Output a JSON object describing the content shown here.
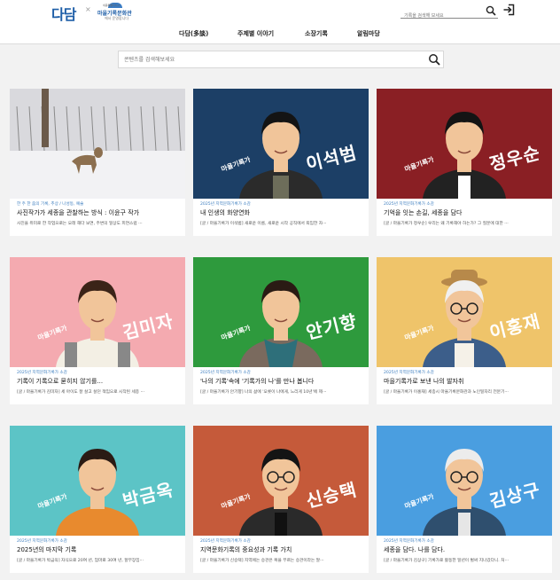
{
  "header": {
    "logo": "다담",
    "logo_dot": "×",
    "org_small": "세종특별자치시",
    "org_name": "마을기록문화관",
    "org_sub": "에서 운영합니다",
    "search_placeholder": "기록을 검색해 보세요"
  },
  "nav": [
    "다담(多談)",
    "주제별 이야기",
    "소장기록",
    "알림마당"
  ],
  "search": {
    "placeholder": "콘텐츠를 검색해보세요"
  },
  "colors": {
    "accent": "#3f7fc0",
    "logo": "#1f5fa8"
  },
  "cards": [
    {
      "category": "한 주 한 줌의 기록, 추상 / 나성동, 예술",
      "title": "사진작가가 세종을 관찰하는 방식 : 이윤구 작가",
      "desc": "사진을 취미로 한 작업으로는 오래 해다 보면, 주변의 일상도 피연스럽 ···",
      "tag": "",
      "name": "",
      "bg": "#e6e6e6"
    },
    {
      "category": "2025년 지역문화기록가 소감",
      "title": "내 인생의 화양연화",
      "desc": "[글 / 마을기록가 이석범]  새로운 이름, 새로운 시작 공직에서 퇴임한 자···",
      "tag": "마을기록가",
      "name": "이석범",
      "bg": "#1c3f66"
    },
    {
      "category": "2025년 지역문화기록가 소감",
      "title": "기억을 잇는 손길, 세종을 담다",
      "desc": "[글 / 마을기록가 정우순]  우리는 왜 기록해야 하는가? 그 질문에 대한 ···",
      "tag": "마을기록가",
      "name": "정우순",
      "bg": "#8a1f24"
    },
    {
      "category": "2025년 지역문화기록가 소감",
      "title": "기록이 기록으로 묻히지 않기를...",
      "desc": "[글 / 마을기록가 김미자]  세 아이도 잘 살고 살던 책임으로 시작된 세종 ···",
      "tag": "마을기록가",
      "name": "김미자",
      "bg": "#f4aab0"
    },
    {
      "category": "2025년 지역문화기록가 소감",
      "title": "'나의 기록'속에 '기록가의 나'를 만나 봅니다",
      "desc": "[글 / 마을기록가 안기향]  나의 삶에 '오롯이 나에게, 느리게 10년'에 제···",
      "tag": "마을기록가",
      "name": "안기향",
      "bg": "#2e9a3d"
    },
    {
      "category": "2025년 지역문화기록가 소감",
      "title": "마을기록가로 보낸 나의 발자취",
      "desc": "[글 / 마을기록가 이홍재]  세종시 마을기록문화관과 노인일자리 전문기···",
      "tag": "마을기록가",
      "name": "이홍재",
      "bg": "#efc46a"
    },
    {
      "category": "2025년 지역문화기록가 소감",
      "title": "2025년의 마지막 기록",
      "desc": "[글 / 마을기록가 박금옥]  자식으로 20여 년, 엄마로 30여 년, 할부장집···",
      "tag": "마을기록가",
      "name": "박금옥",
      "bg": "#5cc4c6"
    },
    {
      "category": "2025년 지역문화기록가 소감",
      "title": "지역문화기록의 중요성과 기록 가치",
      "desc": "[글 / 마을기록가 신승택]  지역에는 승관은 복을 부르는 승관이라는 말···",
      "tag": "마을기록가",
      "name": "신승택",
      "bg": "#c55a3a"
    },
    {
      "category": "2025년 지역문화기록가 소감",
      "title": "세종을 담다. 나를 담다.",
      "desc": "[글 / 마을기록가 김상구]  기록가로 활동한 일년이 벌써 지나갔다니. 처···",
      "tag": "마을기록가",
      "name": "김상구",
      "bg": "#4a9ee0"
    }
  ]
}
